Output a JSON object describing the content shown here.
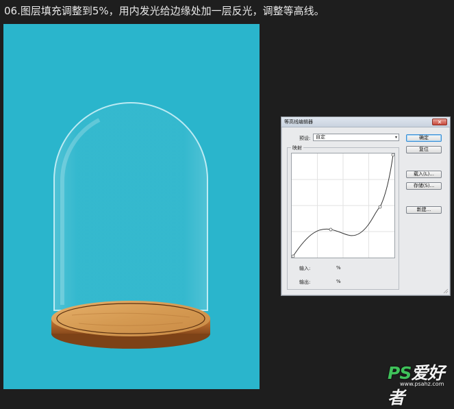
{
  "caption": "06.图层填充调整到5%，用内发光给边缘处加一层反光，调整等高线。",
  "dialog": {
    "title": "等高线编辑器",
    "close_icon": "close-icon",
    "preset_label": "预设:",
    "preset_value": "自定",
    "mapping_label": "映射",
    "input_label": "输入:",
    "input_value": "%",
    "output_label": "输出:",
    "output_value": "%",
    "buttons": {
      "ok": "确定",
      "reset": "复位",
      "load": "载入(L)...",
      "save": "存储(S)...",
      "new": "新建..."
    }
  },
  "watermark": {
    "brand_ps": "PS",
    "brand_text": "爱好者",
    "url": "www.psahz.com"
  },
  "colors": {
    "canvas_bg": "#2ab5cc",
    "page_bg": "#1e1e1e",
    "dialog_bg": "#e9eaec"
  }
}
